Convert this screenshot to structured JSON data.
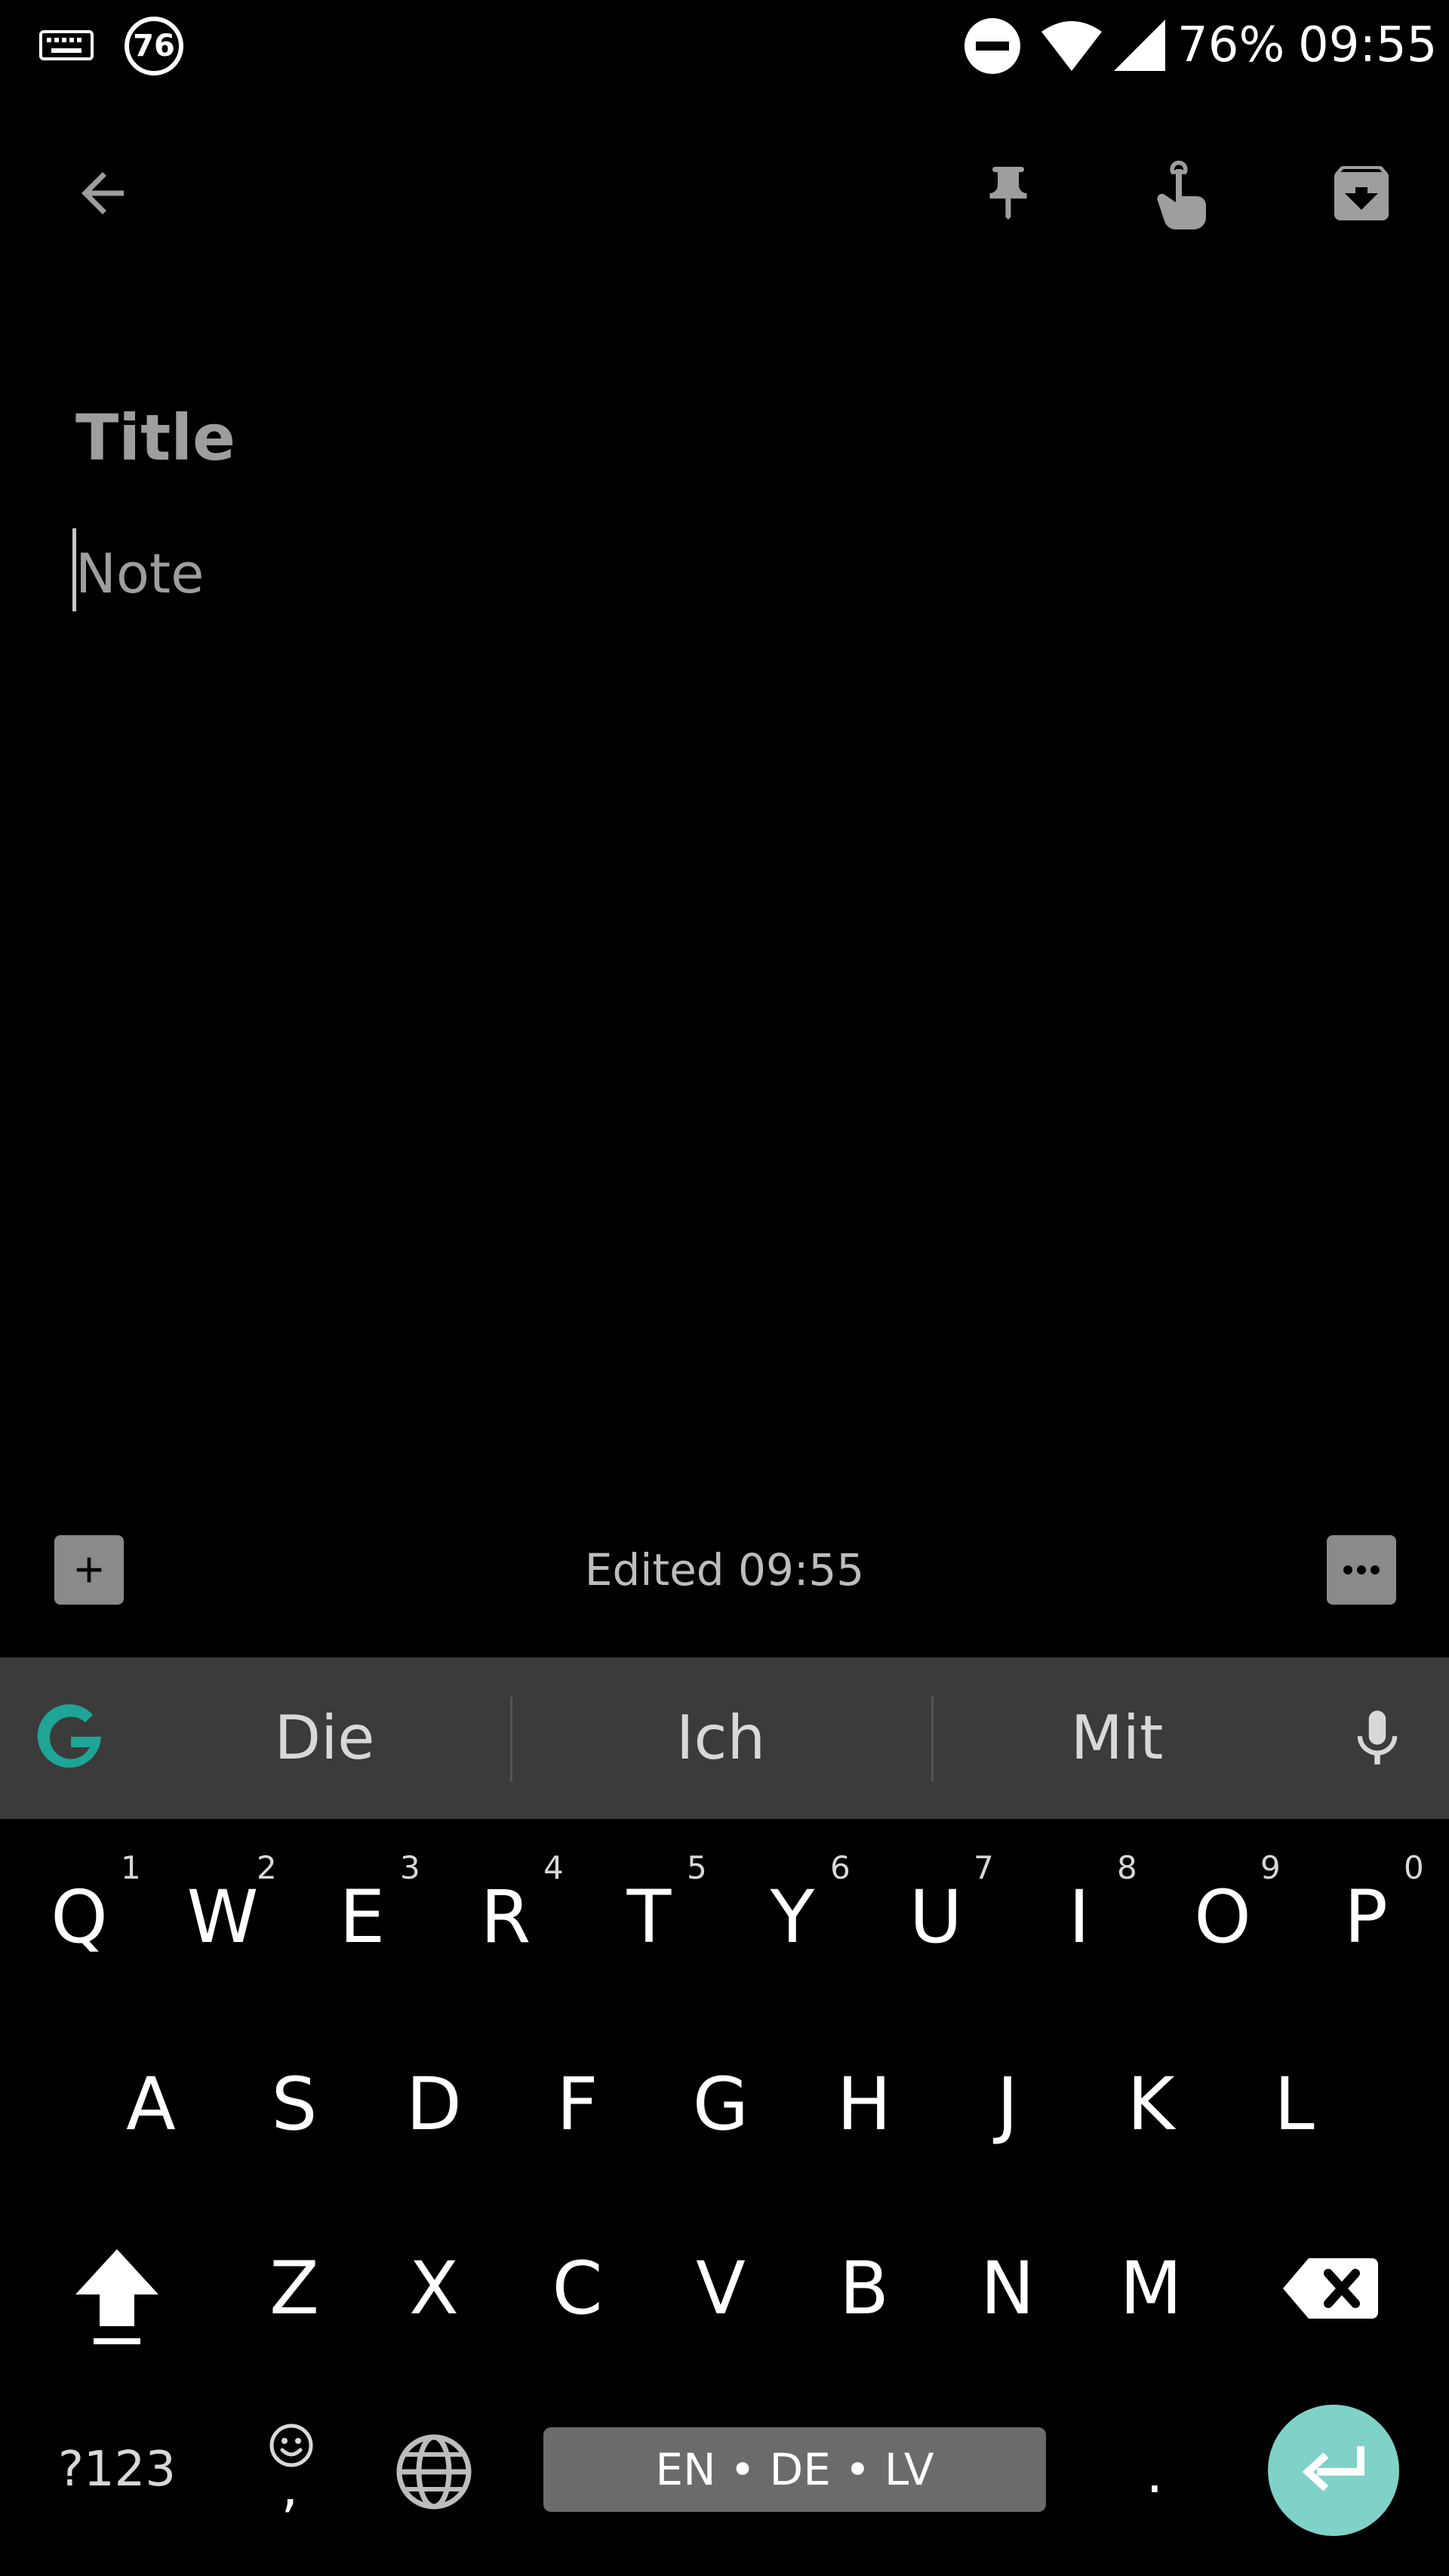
{
  "status_bar": {
    "notification_badge": "76",
    "battery": "76%",
    "time": "09:55",
    "icons": [
      "keyboard-icon",
      "dnd-icon",
      "wifi-icon",
      "signal-icon"
    ]
  },
  "toolbar": {
    "icons": [
      "back-arrow-icon",
      "pin-icon",
      "reminder-icon",
      "archive-icon"
    ]
  },
  "note": {
    "title_placeholder": "Title",
    "body_placeholder": "Note"
  },
  "note_footer": {
    "edited": "Edited 09:55",
    "icons": [
      "add-box-icon",
      "more-options-icon"
    ]
  },
  "suggestions": {
    "words": [
      "Die",
      "Ich",
      "Mit"
    ],
    "icons": [
      "google-g-icon",
      "microphone-icon"
    ],
    "accent_color": "#1fa596"
  },
  "keyboard": {
    "row1": [
      {
        "key": "Q",
        "hint": "1"
      },
      {
        "key": "W",
        "hint": "2"
      },
      {
        "key": "E",
        "hint": "3"
      },
      {
        "key": "R",
        "hint": "4"
      },
      {
        "key": "T",
        "hint": "5"
      },
      {
        "key": "Y",
        "hint": "6"
      },
      {
        "key": "U",
        "hint": "7"
      },
      {
        "key": "I",
        "hint": "8"
      },
      {
        "key": "O",
        "hint": "9"
      },
      {
        "key": "P",
        "hint": "0"
      }
    ],
    "row2": [
      "A",
      "S",
      "D",
      "F",
      "G",
      "H",
      "J",
      "K",
      "L"
    ],
    "row3": [
      "Z",
      "X",
      "C",
      "V",
      "B",
      "N",
      "M"
    ],
    "symbols_key": "?123",
    "comma_key": ",",
    "period_key": ".",
    "space_label": "EN • DE • LV",
    "enter_color": "#7fd2c7"
  }
}
